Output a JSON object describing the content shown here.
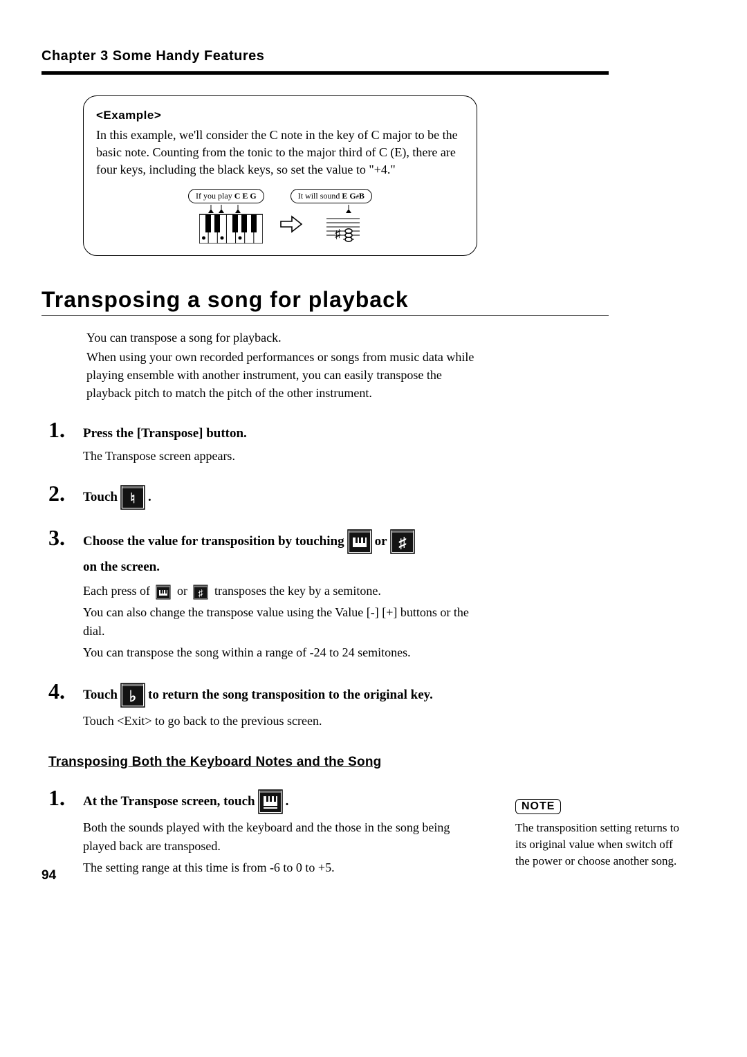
{
  "chapter_header": "Chapter 3 Some Handy Features",
  "example": {
    "title": "<Example>",
    "text": "In this example, we'll consider the C note in the key of C major to be the basic note. Counting from the tonic to the major third of C (E), there are four keys, including the black keys, so set the value to \"+4.\"",
    "bubble1_pre": "If you play ",
    "bubble1_bold": "C E G",
    "bubble2_pre": "It will sound ",
    "bubble2_bold_a": "E G",
    "bubble2_sup": "#",
    "bubble2_bold_b": " B"
  },
  "section_title": "Transposing a song for playback",
  "intro": {
    "p1": "You can transpose a song for playback.",
    "p2": "When using your own recorded performances or songs from music data while playing ensemble with another instrument, you can easily transpose the playback pitch to match the pitch of the other instrument."
  },
  "steps": {
    "s1": {
      "head": "Press the [Transpose] button.",
      "desc": "The Transpose screen appears."
    },
    "s2": {
      "head_pre": "Touch ",
      "head_post": "."
    },
    "s3": {
      "head_pre": "Choose the value for transposition by touching ",
      "head_or": " or ",
      "head_line2": "on the screen.",
      "d1_pre": "Each press of ",
      "d1_or": " or ",
      "d1_post": " transposes the key by a semitone.",
      "d2": "You can also change the transpose value using the Value [-] [+] buttons or the dial.",
      "d3": "You can transpose the song within a range of -24 to 24 semitones."
    },
    "s4": {
      "head_pre": "Touch ",
      "head_post": " to return the song transposition to the original key.",
      "d1": "Touch <Exit> to go back to the previous screen."
    }
  },
  "subsection_title": "Transposing Both the Keyboard Notes and the Song",
  "sub_steps": {
    "s1": {
      "head_pre": "At the Transpose screen, touch ",
      "head_post": ".",
      "d1": "Both the sounds played with the keyboard and the those in the song being played back are transposed.",
      "d2": "The setting range at this time is from -6 to 0 to +5."
    }
  },
  "note": {
    "label": "NOTE",
    "text": "The transposition setting returns to its original value when switch off the power or choose another song."
  },
  "page_number": "94"
}
